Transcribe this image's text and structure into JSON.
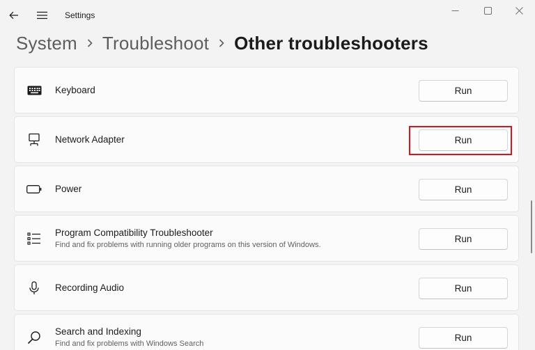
{
  "window": {
    "app_title": "Settings"
  },
  "breadcrumb": {
    "items": [
      "System",
      "Troubleshoot",
      "Other troubleshooters"
    ]
  },
  "troubleshooters": [
    {
      "title": "Keyboard",
      "description": "",
      "icon": "keyboard-icon",
      "button": "Run"
    },
    {
      "title": "Network Adapter",
      "description": "",
      "icon": "network-adapter-icon",
      "button": "Run",
      "highlighted": true
    },
    {
      "title": "Power",
      "description": "",
      "icon": "battery-icon",
      "button": "Run"
    },
    {
      "title": "Program Compatibility Troubleshooter",
      "description": "Find and fix problems with running older programs on this version of Windows.",
      "icon": "list-icon",
      "button": "Run"
    },
    {
      "title": "Recording Audio",
      "description": "",
      "icon": "microphone-icon",
      "button": "Run"
    },
    {
      "title": "Search and Indexing",
      "description": "Find and fix problems with Windows Search",
      "icon": "search-icon",
      "button": "Run"
    }
  ],
  "colors": {
    "background": "#f3f3f3",
    "card": "#fbfbfb",
    "highlight": "#d9141e"
  }
}
